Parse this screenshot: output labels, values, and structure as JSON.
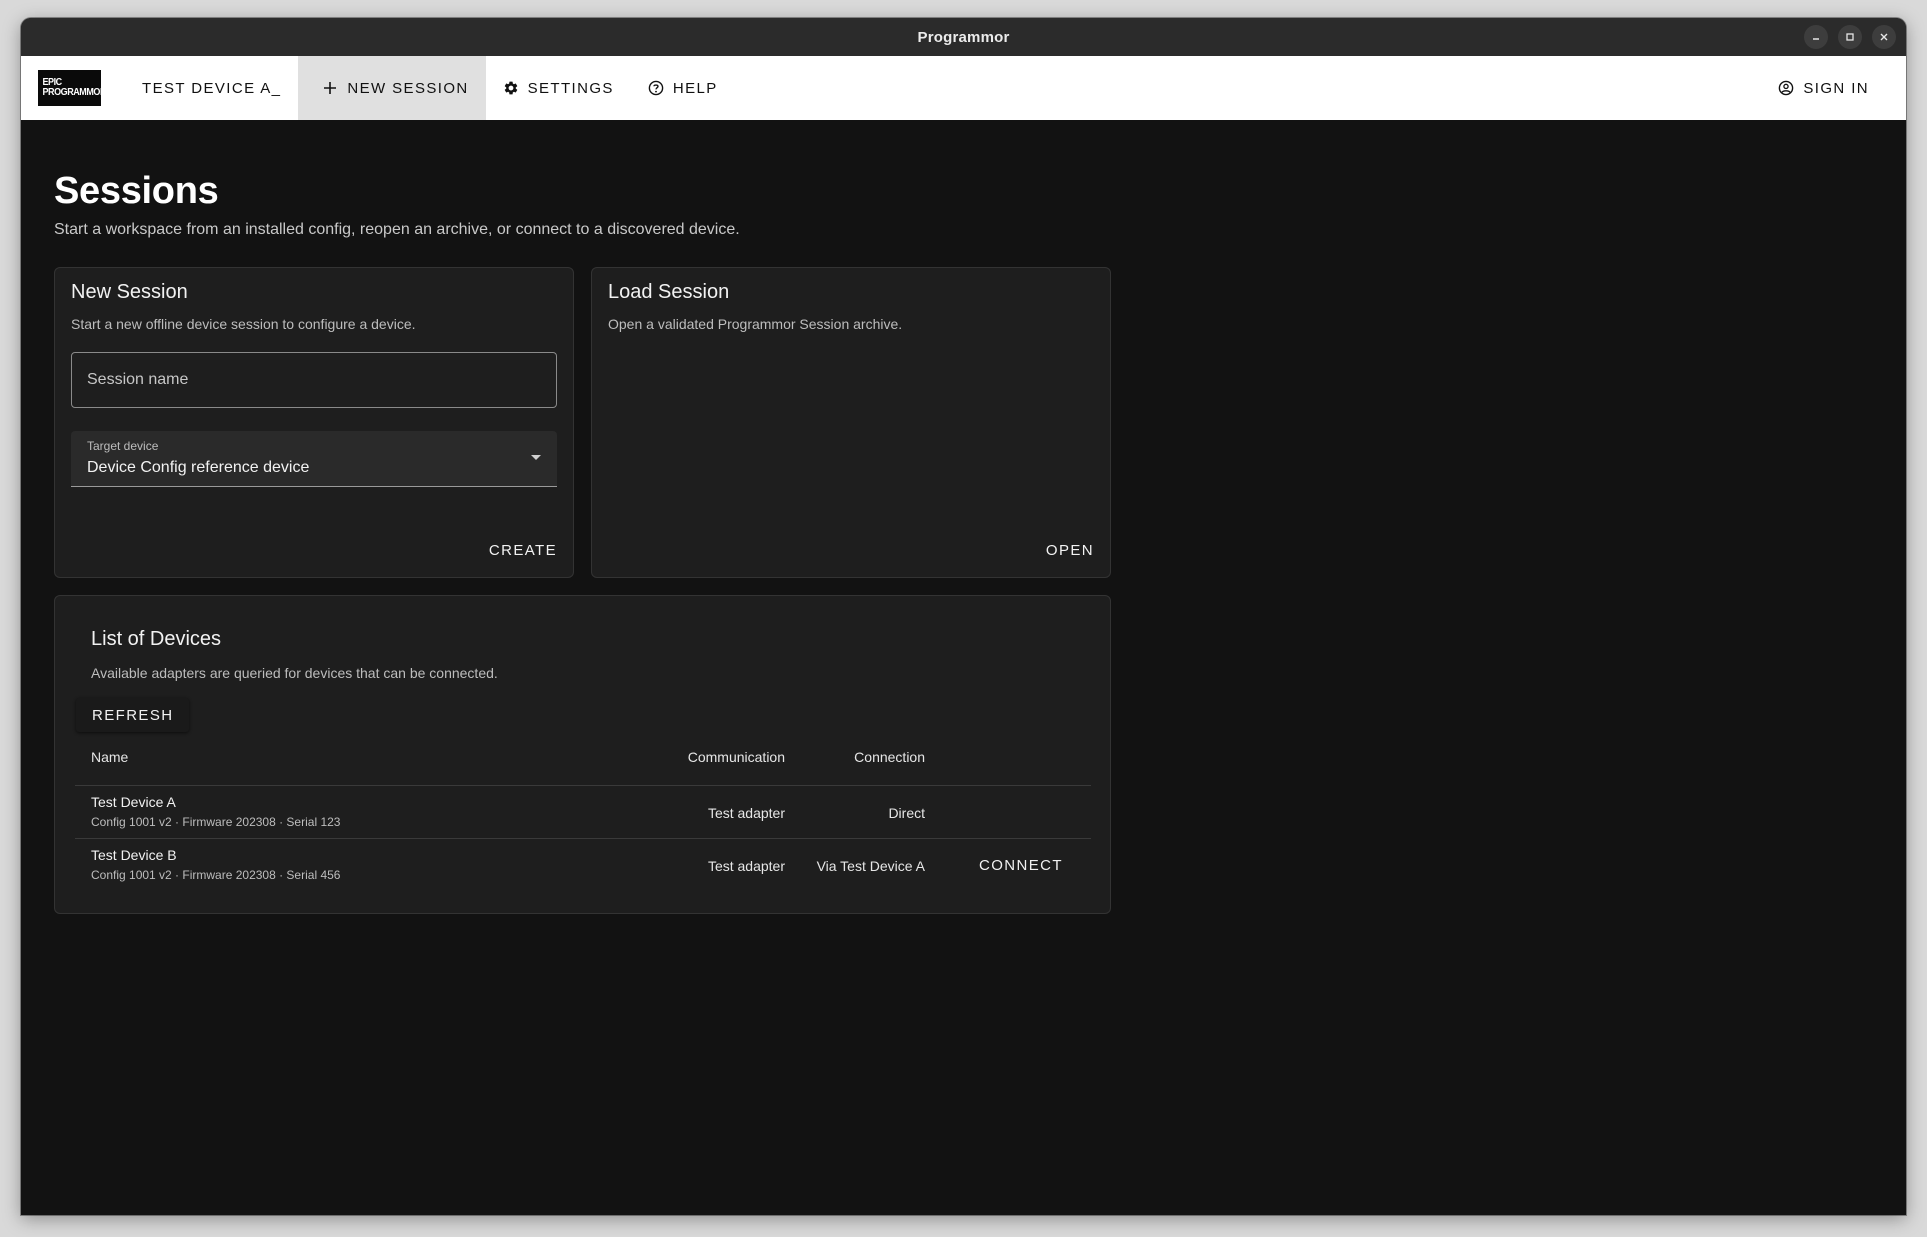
{
  "window": {
    "title": "Programmor"
  },
  "appbar": {
    "logo_line1": "EPIC",
    "logo_line2": "PROGRAMMOR",
    "device_tab": "TEST DEVICE A_",
    "new_session": "NEW SESSION",
    "settings": "SETTINGS",
    "help": "HELP",
    "sign_in": "SIGN IN"
  },
  "page": {
    "title": "Sessions",
    "subtitle": "Start a workspace from an installed config, reopen an archive, or connect to a discovered device."
  },
  "new_session": {
    "title": "New Session",
    "subtitle": "Start a new offline device session to configure a device.",
    "name_placeholder": "Session name",
    "name_value": "",
    "target_label": "Target device",
    "target_value": "Device Config reference device",
    "create_label": "CREATE"
  },
  "load_session": {
    "title": "Load Session",
    "subtitle": "Open a validated Programmor Session archive.",
    "open_label": "OPEN"
  },
  "devices": {
    "title": "List of Devices",
    "subtitle": "Available adapters are queried for devices that can be connected.",
    "refresh_label": "REFRESH",
    "columns": {
      "name": "Name",
      "communication": "Communication",
      "connection": "Connection"
    },
    "rows": [
      {
        "name": "Test Device A",
        "meta": "Config 1001 v2 · Firmware 202308 · Serial 123",
        "communication": "Test adapter",
        "connection": "Direct",
        "action": ""
      },
      {
        "name": "Test Device B",
        "meta": "Config 1001 v2 · Firmware 202308 · Serial 456",
        "communication": "Test adapter",
        "connection": "Via Test Device A",
        "action": "CONNECT"
      }
    ]
  },
  "colors": {
    "background": "#121212",
    "card": "#1e1e1e",
    "appbar": "#ffffff",
    "titlebar": "#2b2b2b"
  }
}
